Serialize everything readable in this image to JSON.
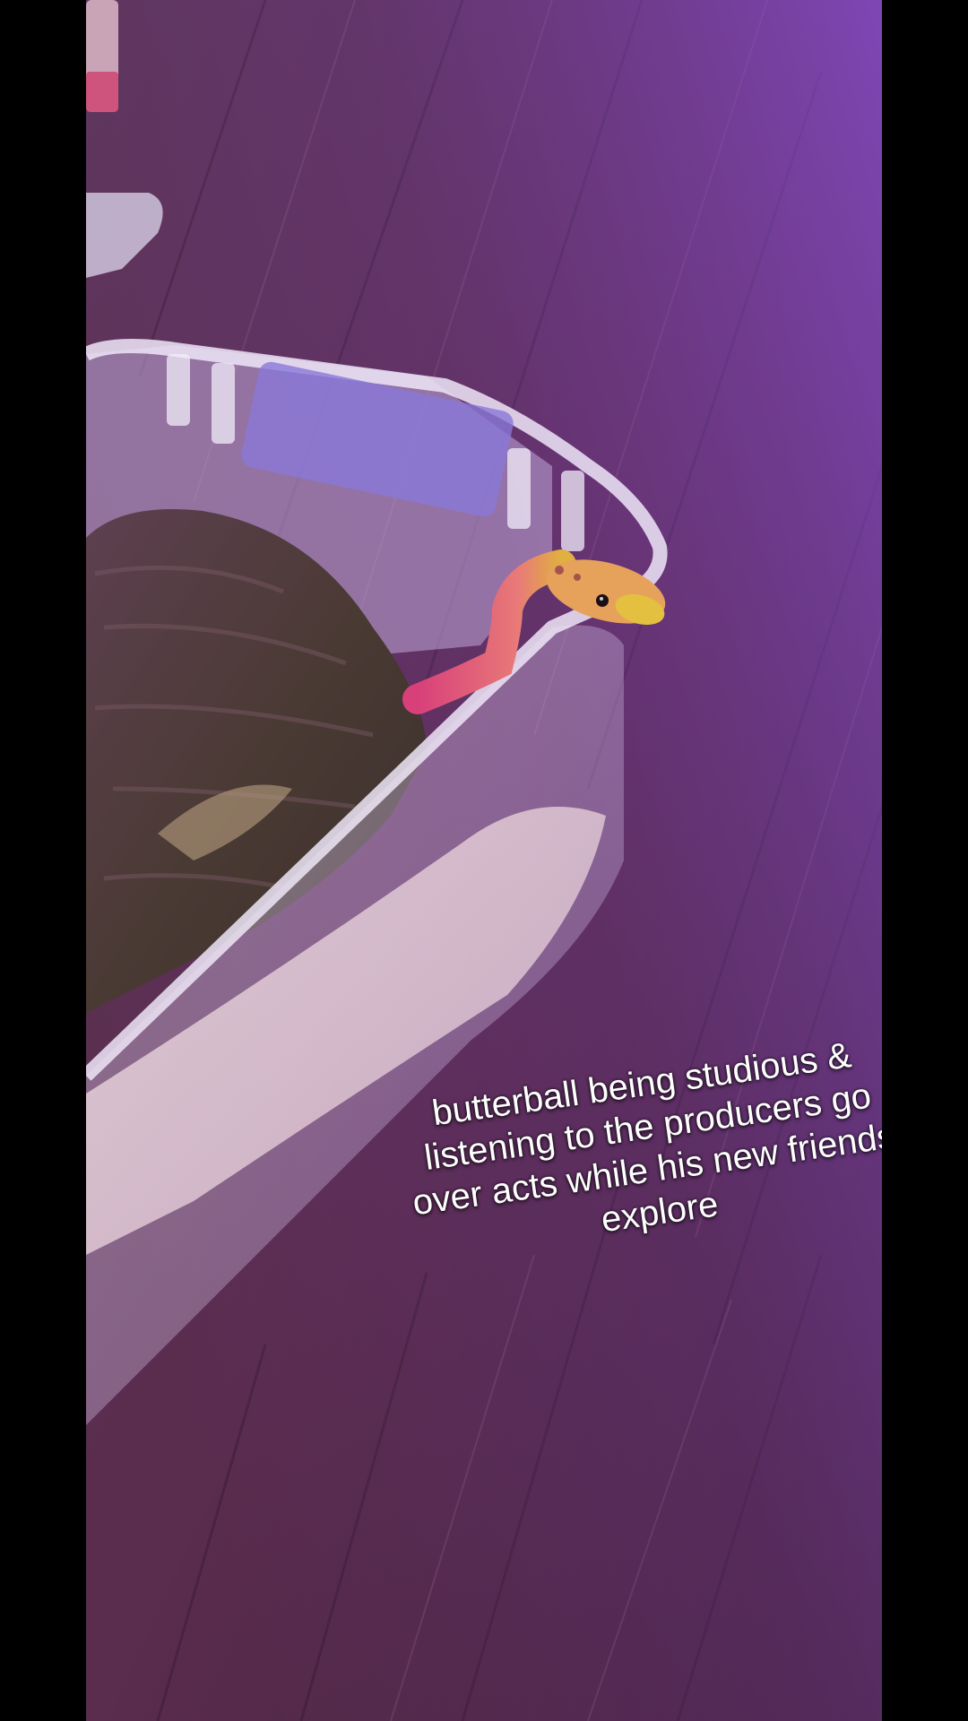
{
  "caption": {
    "lines": [
      "butterball being studious &",
      "listening to the producers go",
      "over acts while his new friends",
      "explore"
    ]
  },
  "scene": {
    "subjects": [
      "snake",
      "plastic-tub",
      "bark-log",
      "paper-towel",
      "wood-floor"
    ],
    "colors": {
      "letterbox": "#000000",
      "floor": "#5a2e4a",
      "snake": "#e0598a",
      "tub": "#d9c6f0"
    }
  }
}
